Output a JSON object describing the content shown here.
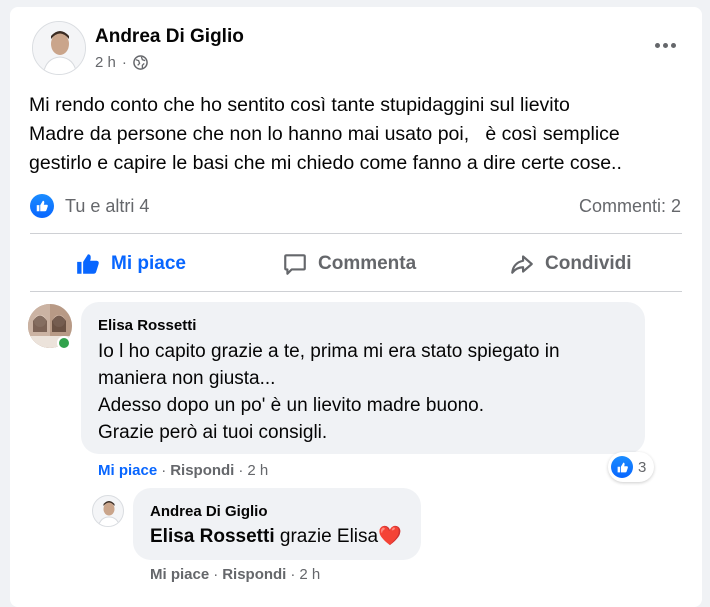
{
  "post": {
    "author": "Andrea Di Giglio",
    "time": "2 h",
    "privacy_icon": "globe-icon",
    "text": "Mi rendo conto che ho sentito così tante stupidaggini sul lievito\nMadre da persone che non lo hanno mai usato poi,   è così semplice\ngestirlo e capire le basi che mi chiedo come fanno a dire certe cose..",
    "reactions_summary": "Tu e altri 4",
    "comments_count": "Commenti: 2"
  },
  "actions": {
    "like": "Mi piace",
    "comment": "Commenta",
    "share": "Condividi"
  },
  "colors": {
    "accent": "#0866ff",
    "secondary_text": "#65676b",
    "bubble": "#f0f2f5",
    "online": "#31a24c"
  },
  "comments": [
    {
      "author": "Elisa Rossetti",
      "text": "Io l ho capito grazie a te, prima mi era stato spiegato in\nmaniera non giusta...\nAdesso dopo un po' è un lievito madre buono.\nGrazie però ai tuoi consigli.",
      "like": "Mi piace",
      "sep": "·",
      "reply": "Rispondi",
      "time": "2 h",
      "reaction_count": "3"
    },
    {
      "author": "Andrea Di Giglio",
      "tag": "Elisa Rossetti",
      "text": " grazie Elisa",
      "emoji": "❤️",
      "like": "Mi piace",
      "sep": "·",
      "reply": "Rispondi",
      "time": "2 h"
    }
  ]
}
